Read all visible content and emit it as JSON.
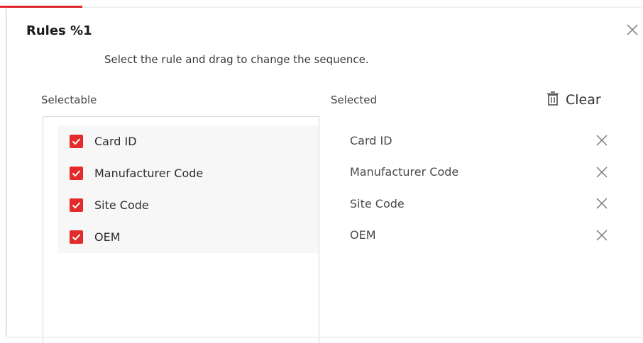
{
  "colors": {
    "accent": "#e8272f",
    "checkbox": "#e32b2b"
  },
  "dialog": {
    "title": "Rules %1",
    "hint": "Select the rule and drag to change the sequence.",
    "close_icon": "close-icon"
  },
  "selectable": {
    "label": "Selectable",
    "items": [
      {
        "label": "Card ID",
        "checked": true
      },
      {
        "label": "Manufacturer Code",
        "checked": true
      },
      {
        "label": "Site Code",
        "checked": true
      },
      {
        "label": "OEM",
        "checked": true
      }
    ]
  },
  "selected": {
    "label": "Selected",
    "clear_label": "Clear",
    "clear_icon": "trash-icon",
    "items": [
      {
        "label": "Card ID"
      },
      {
        "label": "Manufacturer Code"
      },
      {
        "label": "Site Code"
      },
      {
        "label": "OEM"
      }
    ]
  }
}
